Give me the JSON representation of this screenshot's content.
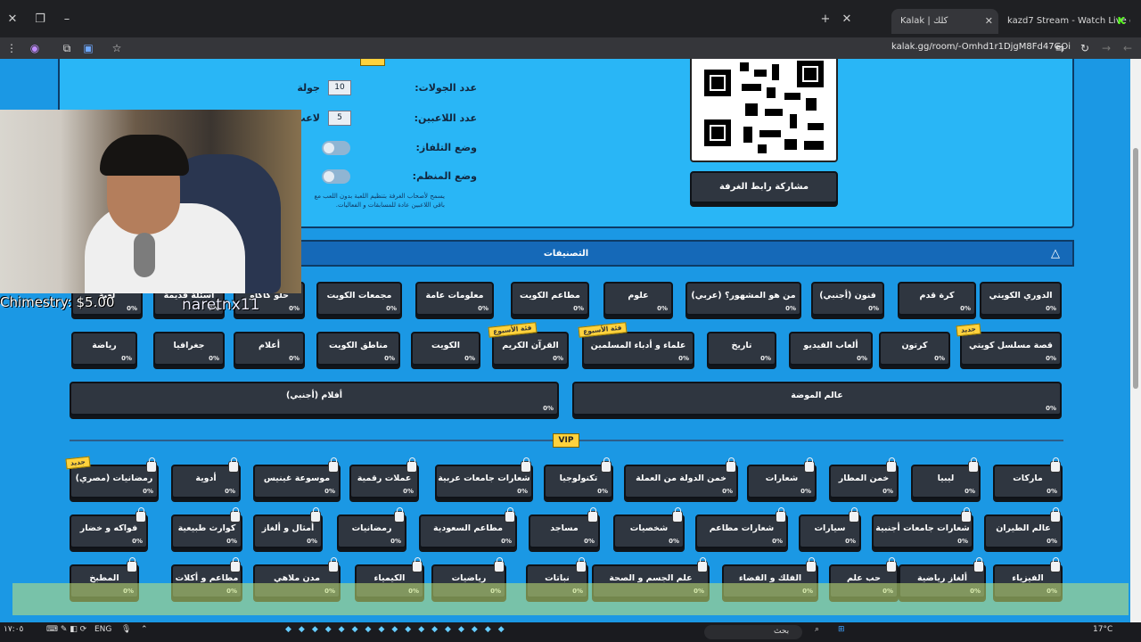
{
  "browser": {
    "tabs": [
      {
        "title": "Kalak | كلك",
        "active": true
      },
      {
        "title": "kazd7 Stream - Watch Live on",
        "active": false
      }
    ],
    "url": "kalak.gg/room/-Omhd1r1DjgM8Fd47GOi"
  },
  "settings": {
    "rounds_label": "عدد الجولات:",
    "rounds_value": "10",
    "rounds_unit": "جولة",
    "players_label": "عدد اللاعبين:",
    "players_value": "5",
    "players_unit": "لاعب",
    "tv_mode_label": "وضع التلفاز:",
    "organizer_mode_label": "وضع المنظم:",
    "organizer_note": "يسمح لأصحاب الغرفة بتنظيم اللعبة بدون اللعب مع باقي اللاعبين عادة للمسابقات و الفعاليات.",
    "share_button": "مشاركة رابط الغرفة"
  },
  "categories_header": "التصنيفات",
  "categories_row1": [
    {
      "label": "الدوري الكويتي",
      "pct": "0%"
    },
    {
      "label": "كرة قدم",
      "pct": "0%"
    },
    {
      "label": "فنون (أجنبي)",
      "pct": "0%"
    },
    {
      "label": "من هو المشهور؟ (عربي)",
      "pct": "0%"
    },
    {
      "label": "علوم",
      "pct": "0%"
    },
    {
      "label": "مطاعم الكويت",
      "pct": "0%"
    },
    {
      "label": "معلومات عامة",
      "pct": "0%"
    },
    {
      "label": "مجمعات الكويت",
      "pct": "0%"
    },
    {
      "label": "حلو كاكاو",
      "pct": "0%"
    },
    {
      "label": "أسئلة قديمة",
      "pct": "0%"
    },
    {
      "label": "لعبة",
      "pct": "0%"
    }
  ],
  "categories_row2": [
    {
      "label": "قصة مسلسل كويتي",
      "pct": "0%",
      "badge": "جديد"
    },
    {
      "label": "كرتون",
      "pct": "0%"
    },
    {
      "label": "ألعاب الفيديو",
      "pct": "0%"
    },
    {
      "label": "تاريخ",
      "pct": "0%"
    },
    {
      "label": "علماء و أدباء المسلمين",
      "pct": "0%",
      "badge": "فئة الأسبوع"
    },
    {
      "label": "القرآن الكريم",
      "pct": "0%",
      "badge": "فئة الأسبوع"
    },
    {
      "label": "الكويت",
      "pct": "0%"
    },
    {
      "label": "مناطق الكويت",
      "pct": "0%"
    },
    {
      "label": "أعلام",
      "pct": "0%"
    },
    {
      "label": "جغرافيا",
      "pct": "0%"
    },
    {
      "label": "رياضة",
      "pct": "0%"
    }
  ],
  "categories_row3": [
    {
      "label": "عالم الموضة",
      "pct": "0%"
    },
    {
      "label": "أفلام (أجنبي)",
      "pct": "0%"
    }
  ],
  "vip_label": "VIP",
  "vip_row1": [
    {
      "label": "ماركات",
      "pct": "0%"
    },
    {
      "label": "ليبيا",
      "pct": "0%"
    },
    {
      "label": "خمن المطار",
      "pct": "0%"
    },
    {
      "label": "شعارات",
      "pct": "0%"
    },
    {
      "label": "خمن الدولة من العملة",
      "pct": "0%"
    },
    {
      "label": "تكنولوجيا",
      "pct": "0%"
    },
    {
      "label": "شعارات جامعات عربية",
      "pct": "0%"
    },
    {
      "label": "عملات رقمية",
      "pct": "0%"
    },
    {
      "label": "موسوعة غينيس",
      "pct": "0%"
    },
    {
      "label": "أدوية",
      "pct": "0%"
    },
    {
      "label": "رمضانيات (مصري)",
      "pct": "0%",
      "badge": "جديد"
    }
  ],
  "vip_row2": [
    {
      "label": "عالم الطيران",
      "pct": "0%"
    },
    {
      "label": "شعارات جامعات أجنبية",
      "pct": "0%"
    },
    {
      "label": "سيارات",
      "pct": "0%"
    },
    {
      "label": "شعارات مطاعم",
      "pct": "0%"
    },
    {
      "label": "شخصيات",
      "pct": "0%"
    },
    {
      "label": "مساجد",
      "pct": "0%"
    },
    {
      "label": "مطاعم السعودية",
      "pct": "0%"
    },
    {
      "label": "رمضانيات",
      "pct": "0%"
    },
    {
      "label": "أمثال و ألغاز",
      "pct": "0%"
    },
    {
      "label": "كوارث طبيعية",
      "pct": "0%"
    },
    {
      "label": "فواكه و خضار",
      "pct": "0%"
    }
  ],
  "vip_row3": [
    {
      "label": "الفيزياء",
      "pct": "0%"
    },
    {
      "label": "ألغاز رياضية",
      "pct": "0%"
    },
    {
      "label": "حب علم",
      "pct": "0%"
    },
    {
      "label": "الفلك و الفضاء",
      "pct": "0%"
    },
    {
      "label": "علم الجسم و الصحة",
      "pct": "0%"
    },
    {
      "label": "نباتات",
      "pct": "0%"
    },
    {
      "label": "رياضيات",
      "pct": "0%"
    },
    {
      "label": "الكيمياء",
      "pct": "0%"
    },
    {
      "label": "مدن ملاهي",
      "pct": "0%"
    },
    {
      "label": "مطاعم و أكلات",
      "pct": "0%"
    },
    {
      "label": "المطبخ",
      "pct": "0%"
    }
  ],
  "overlay": {
    "chimestry": "Chimestry: $5.00",
    "handle": "naretnx11"
  },
  "taskbar": {
    "lang": "ENG",
    "time": "١٧:٠٥",
    "search": "بحث",
    "weather": "17°C"
  }
}
